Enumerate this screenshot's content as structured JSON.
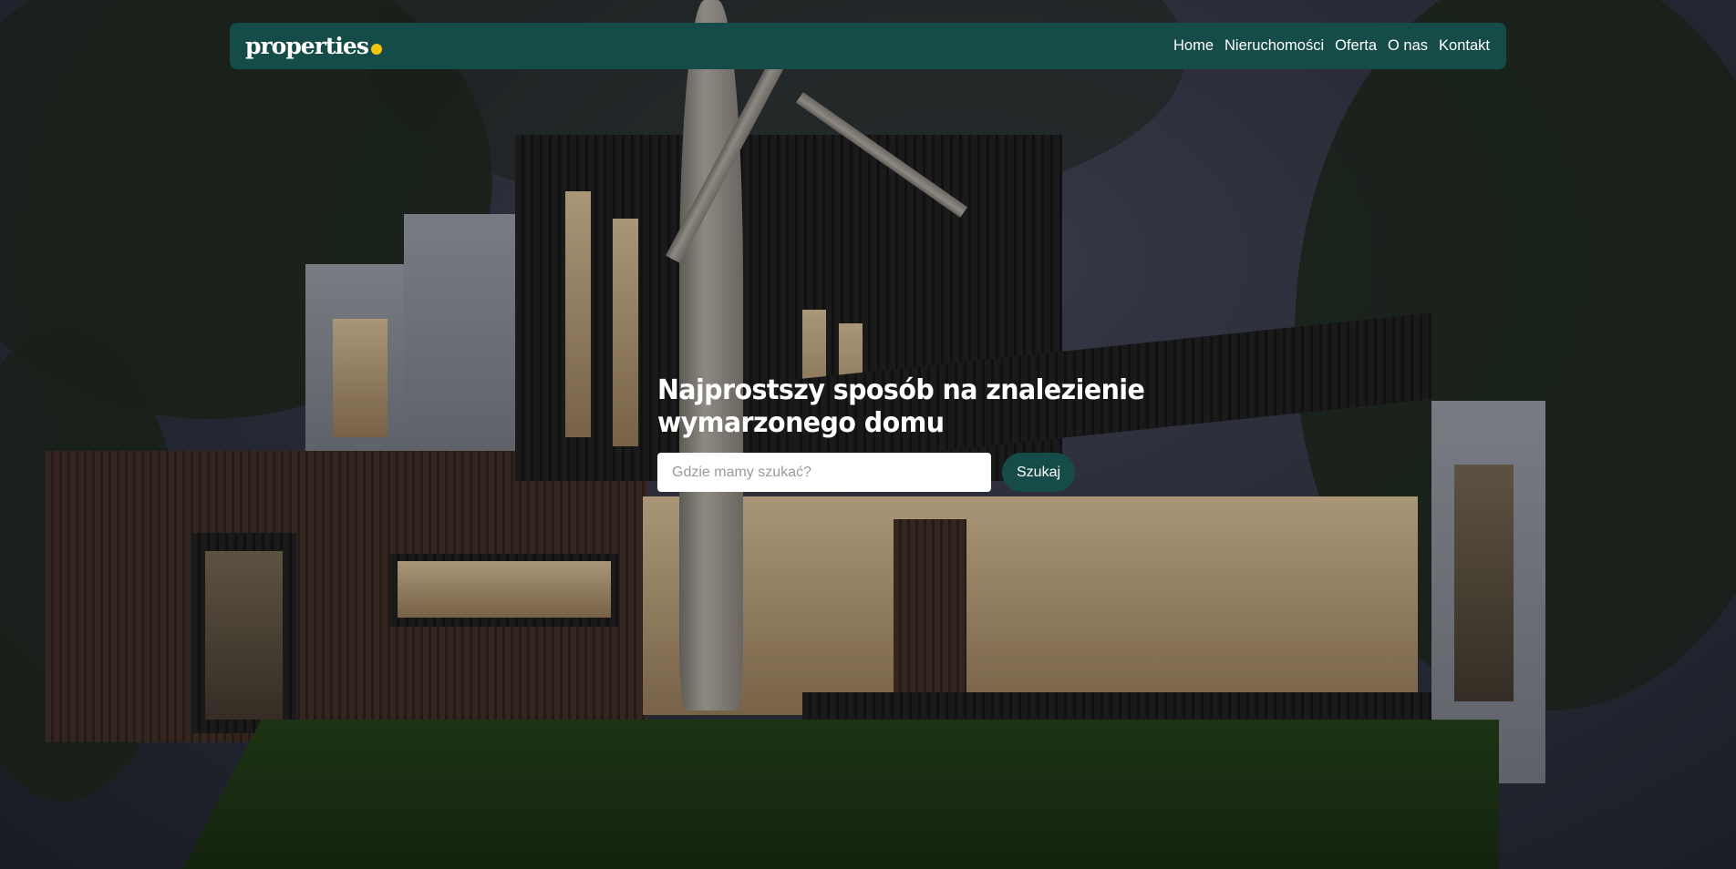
{
  "brand": {
    "name": "properties",
    "dot_color": "#f1c40f"
  },
  "nav": {
    "items": [
      "Home",
      "Nieruchomości",
      "Oferta",
      "O nas",
      "Kontakt"
    ]
  },
  "hero": {
    "title_line1": "Najprostszy sposób na znalezienie",
    "title_line2": "wymarzonego domu",
    "search_placeholder": "Gdzie mamy szukać?",
    "search_button": "Szukaj"
  },
  "colors": {
    "primary": "#154c47",
    "accent": "#f1c40f",
    "text": "#ffffff"
  }
}
